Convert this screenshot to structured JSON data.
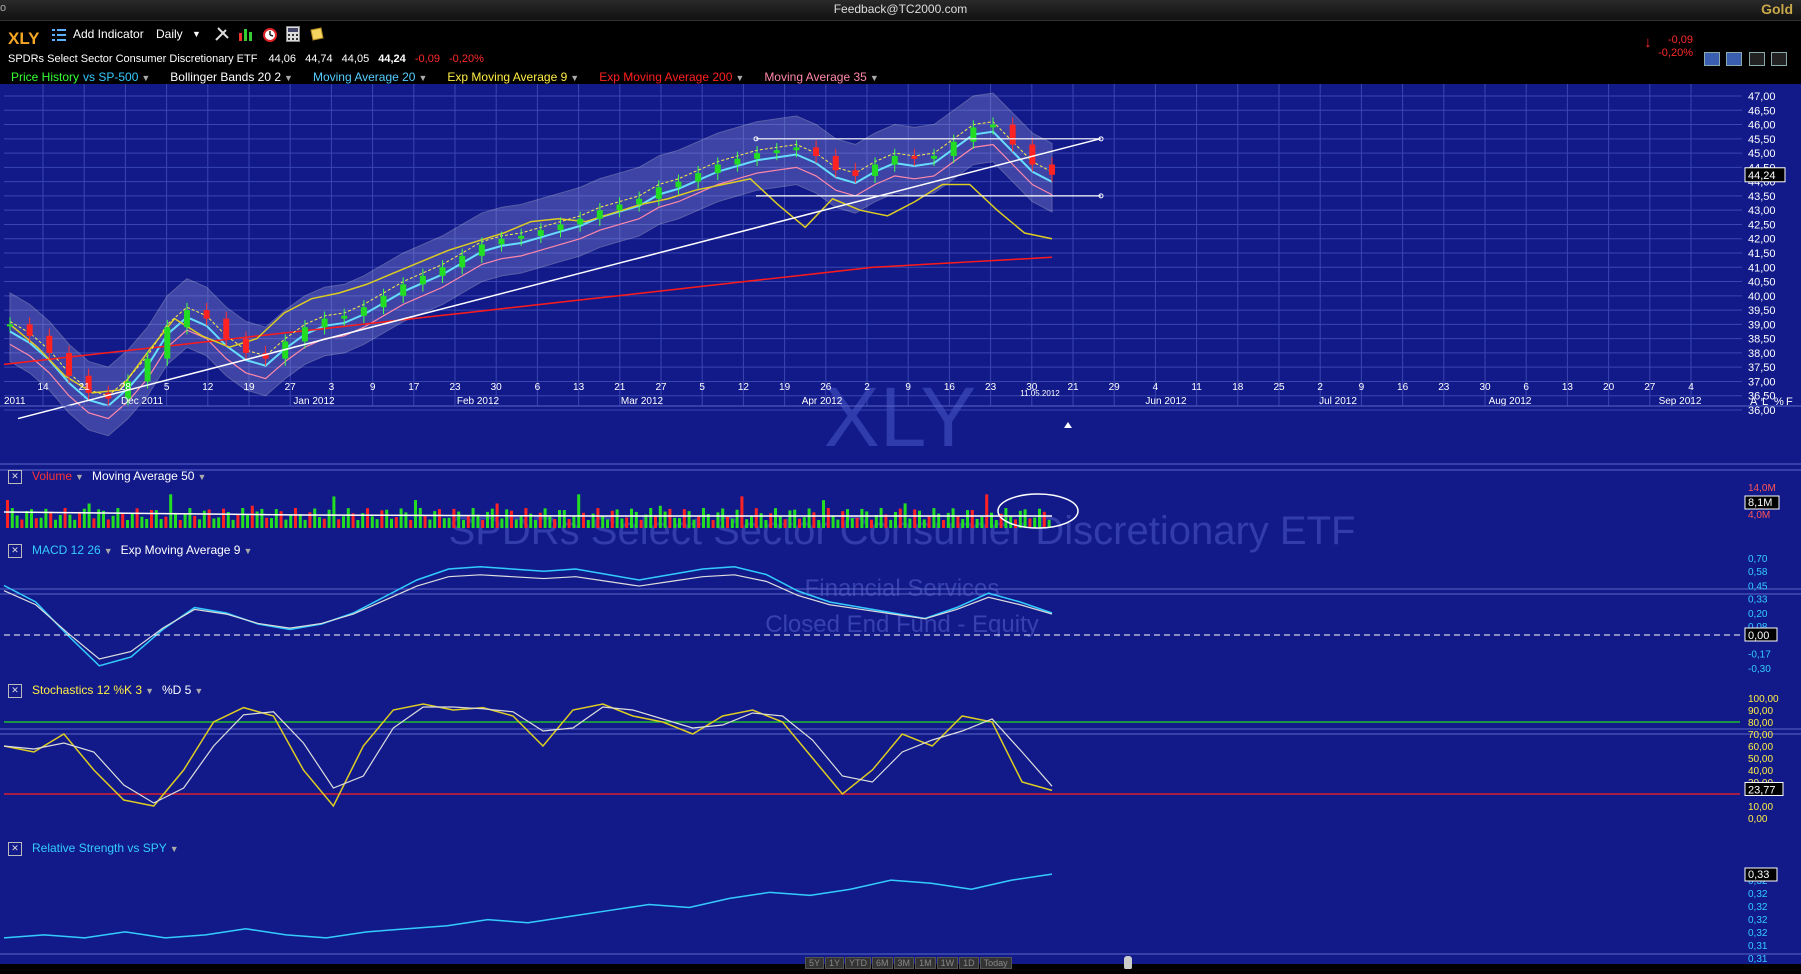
{
  "window": {
    "title": "Feedback@TC2000.com",
    "brand": "Gold",
    "left_mark": "o"
  },
  "toolbar": {
    "symbol": "XLY",
    "add_indicator": "Add Indicator",
    "timeframe": "Daily"
  },
  "quote": {
    "name": "SPDRs Select Sector Consumer Discretionary ETF",
    "open": "44,06",
    "high": "44,74",
    "low": "44,05",
    "last": "44,24",
    "change": "-0,09",
    "change_pct": "-0,20%"
  },
  "change_box": {
    "change": "-0,09",
    "change_pct": "-0,20%"
  },
  "legend": [
    {
      "label": "Price History",
      "color": "#33ff33"
    },
    {
      "label": "vs SP-500",
      "color": "#33ccff"
    },
    {
      "label": "Bollinger Bands 20 2",
      "color": "#ffffff"
    },
    {
      "label": "Moving Average 20",
      "color": "#55ccff"
    },
    {
      "label": "Exp Moving Average 9",
      "color": "#ffee44"
    },
    {
      "label": "Exp Moving Average 200",
      "color": "#ff2020"
    },
    {
      "label": "Moving Average 35",
      "color": "#ff88aa"
    }
  ],
  "watermark": {
    "symbol": "XLY",
    "name": "SPDRs Select Sector Consumer Discretionary ETF",
    "sector": "Financial Services",
    "industry": "Closed End Fund - Equity"
  },
  "price_axis": {
    "labels": [
      "47,00",
      "46,50",
      "46,00",
      "45,50",
      "45,00",
      "44,50",
      "44,00",
      "43,50",
      "43,00",
      "42,50",
      "42,00",
      "41,50",
      "41,00",
      "40,50",
      "40,00",
      "39,50",
      "39,00",
      "38,50",
      "38,00",
      "37,50",
      "37,00",
      "36,50",
      "36,00"
    ],
    "last": "44,24"
  },
  "date_axis": {
    "days": [
      "14",
      "21",
      "28",
      "5",
      "12",
      "19",
      "27",
      "3",
      "9",
      "17",
      "23",
      "30",
      "6",
      "13",
      "21",
      "27",
      "5",
      "12",
      "19",
      "26",
      "2",
      "9",
      "16",
      "23",
      "30",
      "21",
      "29",
      "4",
      "11",
      "18",
      "25",
      "2",
      "9",
      "16",
      "23",
      "30",
      "6",
      "13",
      "20",
      "27",
      "4"
    ],
    "months": [
      "2011",
      "Dec 2011",
      "Jan 2012",
      "Feb 2012",
      "Mar 2012",
      "Apr 2012",
      "Jun 2012",
      "Jul 2012",
      "Aug 2012",
      "Sep 2012"
    ],
    "marker_date": "11.05.2012"
  },
  "axis_toggle": [
    "A",
    "L",
    "%",
    "F"
  ],
  "volume_panel": {
    "title": "Volume",
    "overlay": "Moving Average 50",
    "labels": [
      "14,0M",
      "8,1M",
      "4,0M"
    ],
    "last": "8,1M"
  },
  "macd_panel": {
    "title": "MACD 12 26",
    "overlay": "Exp Moving Average 9",
    "labels": [
      "0,70",
      "0,58",
      "0,45",
      "0,33",
      "0,20",
      "0,08",
      "-0,17",
      "-0,30"
    ],
    "last": "0,00"
  },
  "stoch_panel": {
    "title": "Stochastics 12 %K 3",
    "overlay": "%D 5",
    "labels": [
      "100,00",
      "90,00",
      "80,00",
      "70,00",
      "60,00",
      "50,00",
      "40,00",
      "30,00",
      "10,00",
      "0,00"
    ],
    "last": "23,77"
  },
  "rs_panel": {
    "title": "Relative Strength vs SPY",
    "labels": [
      "0,32",
      "0,32",
      "0,32",
      "0,32",
      "0,32",
      "0,31",
      "0,31"
    ],
    "last": "0,33"
  },
  "bottom_ranges": [
    "5Y",
    "1Y",
    "YTD",
    "6M",
    "3M",
    "1M",
    "1W",
    "1D",
    "Today"
  ],
  "chart_data": [
    {
      "type": "line",
      "title": "XLY",
      "xlabel": "",
      "ylabel": "",
      "ylim": [
        36.0,
        47.0
      ],
      "series": [
        {
          "name": "Price History",
          "values": [
            39.0,
            38.6,
            38.0,
            37.2,
            36.6,
            36.4,
            37.0,
            37.8,
            38.9,
            39.5,
            39.2,
            38.5,
            38.0,
            37.8,
            38.4,
            38.9,
            39.2,
            39.3,
            39.6,
            40.0,
            40.4,
            40.7,
            41.0,
            41.4,
            41.8,
            42.0,
            42.1,
            42.3,
            42.5,
            42.7,
            43.0,
            43.2,
            43.4,
            43.8,
            44.0,
            44.3,
            44.6,
            44.8,
            45.0,
            45.1,
            45.2,
            44.9,
            44.4,
            44.2,
            44.6,
            44.9,
            44.8,
            44.9,
            45.4,
            45.9,
            46.0,
            45.3,
            44.6,
            44.24
          ]
        },
        {
          "name": "Exp Moving Average 200",
          "values": [
            37.6,
            37.7,
            37.8,
            37.9,
            38.0,
            38.1,
            38.2,
            38.3,
            38.4,
            38.5,
            38.6,
            38.7,
            38.8,
            38.9,
            39.0,
            39.1,
            39.2,
            39.3,
            39.4,
            39.5,
            39.6,
            39.7,
            39.8,
            39.9,
            40.0,
            40.1,
            40.2,
            40.3,
            40.4,
            40.5,
            40.6,
            40.7,
            40.8,
            40.9,
            41.0,
            41.05,
            41.1,
            41.15,
            41.2,
            41.25,
            41.3,
            41.35
          ]
        },
        {
          "name": "vs SP-500",
          "values": [
            39.0,
            38.2,
            37.2,
            36.6,
            36.7,
            38.0,
            39.2,
            38.6,
            38.2,
            38.5,
            39.4,
            39.9,
            40.1,
            40.4,
            40.8,
            41.2,
            41.6,
            41.9,
            42.2,
            42.6,
            42.7,
            42.6,
            42.9,
            43.2,
            43.4,
            43.7,
            43.9,
            44.1,
            43.2,
            42.4,
            43.4,
            43.0,
            42.8,
            43.3,
            43.9,
            43.9,
            43.0,
            42.2,
            42.0
          ]
        }
      ]
    },
    {
      "type": "bar",
      "title": "Volume",
      "ylim": [
        0,
        14.0
      ],
      "last": 8.1
    },
    {
      "type": "line",
      "title": "MACD 12 26",
      "ylim": [
        -0.3,
        0.7
      ],
      "last": 0.0
    },
    {
      "type": "line",
      "title": "Stochastics 12 %K 3",
      "ylim": [
        0,
        100
      ],
      "last": 23.77
    },
    {
      "type": "line",
      "title": "Relative Strength vs SPY",
      "ylim": [
        0.31,
        0.33
      ],
      "last": 0.33
    }
  ]
}
